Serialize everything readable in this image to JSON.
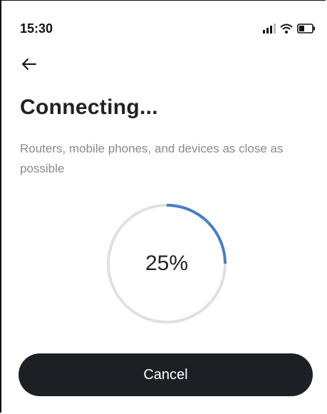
{
  "status_bar": {
    "time": "15:30",
    "icons": [
      "cellular-signal-icon",
      "wifi-icon",
      "battery-icon"
    ]
  },
  "navigation": {
    "back_icon": "back-arrow-icon"
  },
  "title": "Connecting...",
  "description": "Routers, mobile phones, and devices as close as possible",
  "progress": {
    "percent": 25,
    "label": "25%",
    "accent_color": "#4a7fbf",
    "track_color": "#e0e0e0"
  },
  "cancel_button": {
    "label": "Cancel",
    "color": "#1d1f24"
  }
}
